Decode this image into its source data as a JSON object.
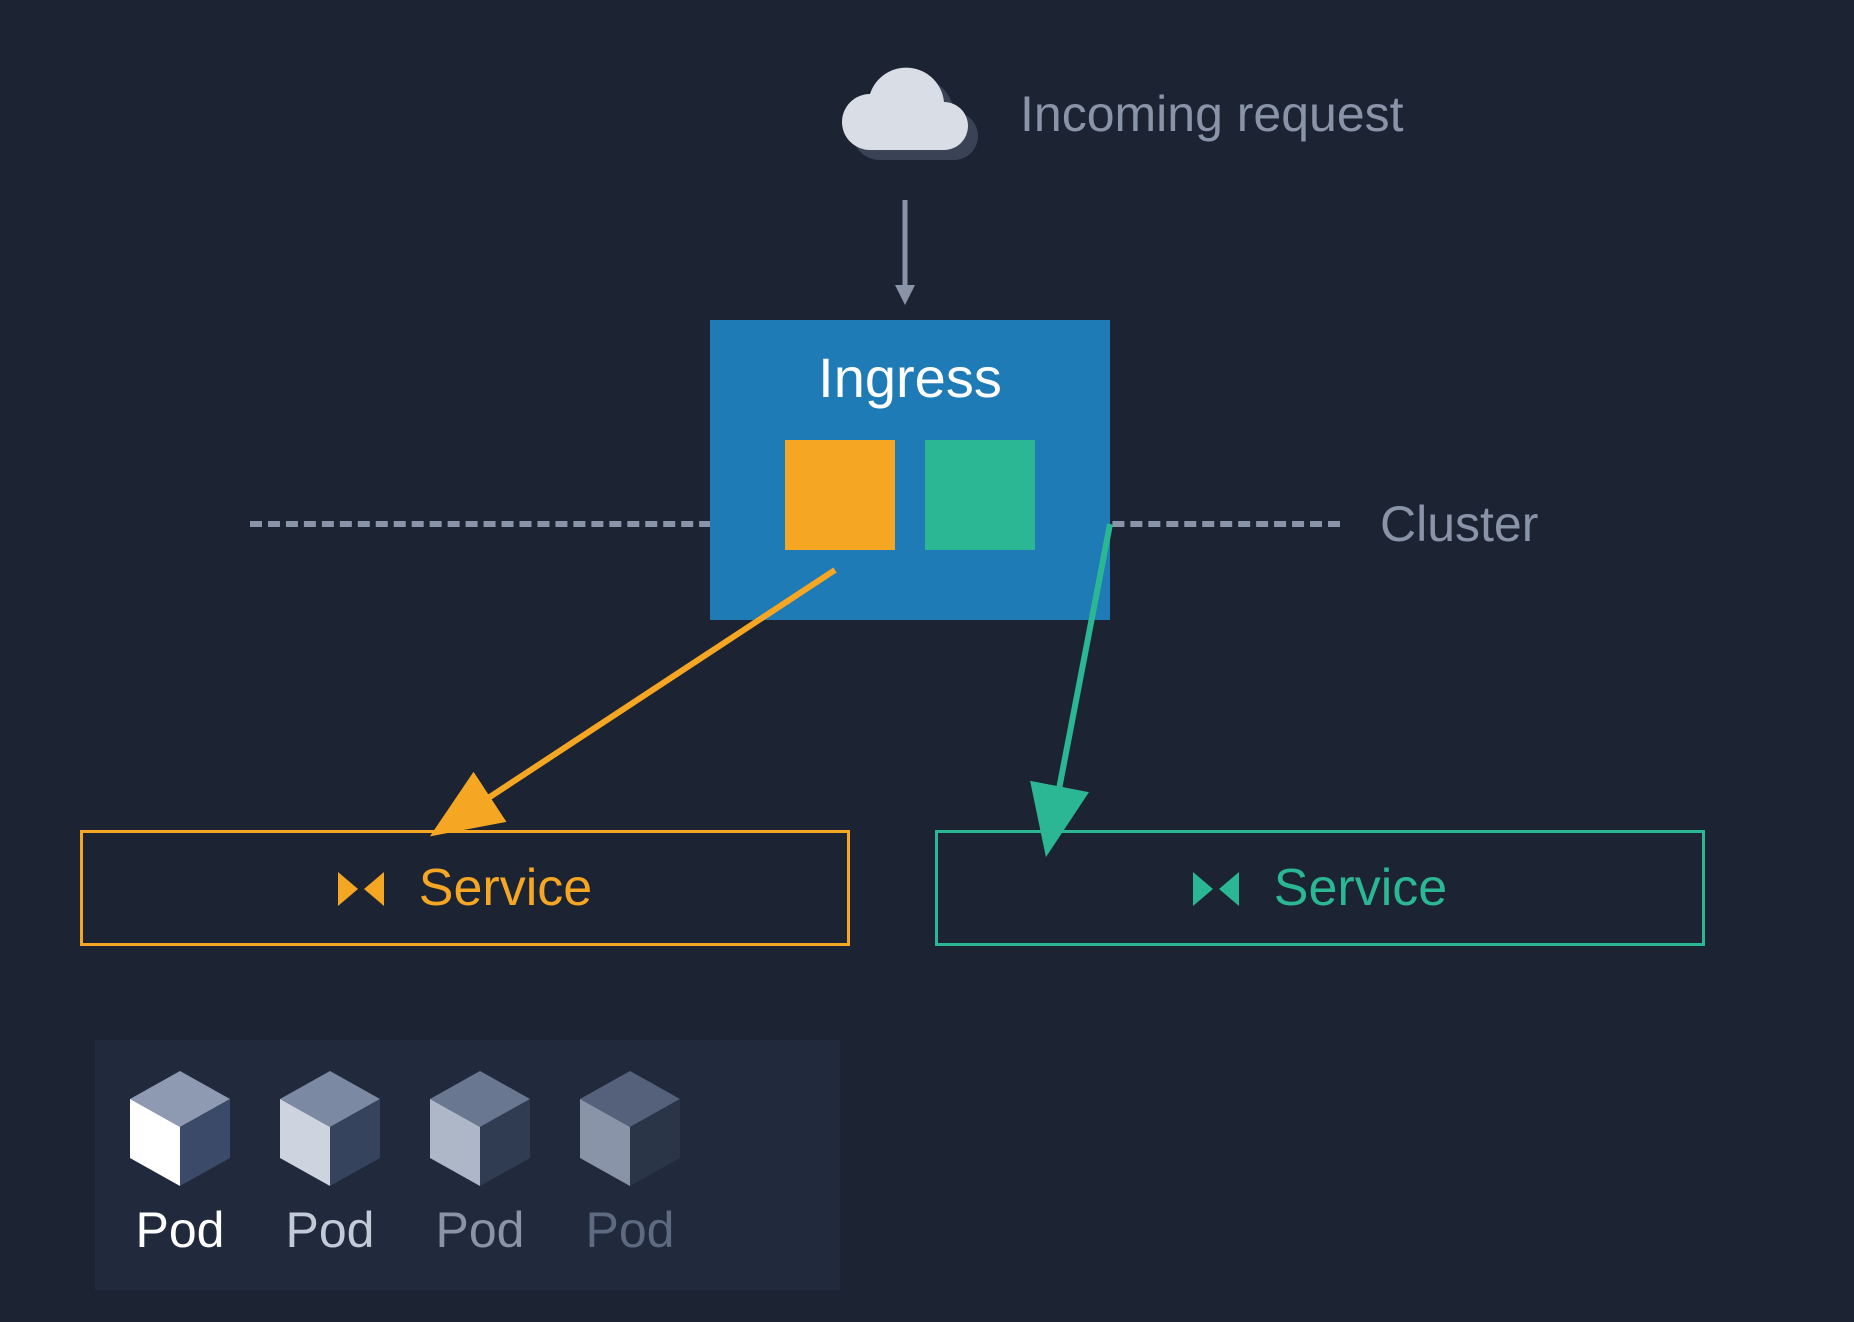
{
  "labels": {
    "incoming": "Incoming request",
    "ingress": "Ingress",
    "cluster": "Cluster",
    "service_left": "Service",
    "service_right": "Service"
  },
  "pods": [
    "Pod",
    "Pod",
    "Pod",
    "Pod"
  ],
  "colors": {
    "bg": "#1c2333",
    "orange": "#f5a623",
    "green": "#2bb793",
    "blue": "#1f7bb6",
    "muted": "#8a94a8",
    "white": "#ffffff"
  },
  "diagram": {
    "type": "architecture",
    "nodes": [
      {
        "id": "cloud",
        "label": "Incoming request"
      },
      {
        "id": "ingress",
        "label": "Ingress",
        "routes": [
          "orange",
          "green"
        ]
      },
      {
        "id": "service-orange",
        "label": "Service"
      },
      {
        "id": "service-green",
        "label": "Service"
      },
      {
        "id": "pods",
        "count": 4,
        "label": "Pod"
      }
    ],
    "edges": [
      {
        "from": "cloud",
        "to": "ingress"
      },
      {
        "from": "ingress",
        "to": "service-orange",
        "color": "orange"
      },
      {
        "from": "ingress",
        "to": "service-green",
        "color": "green"
      }
    ],
    "boundary": "Cluster"
  }
}
